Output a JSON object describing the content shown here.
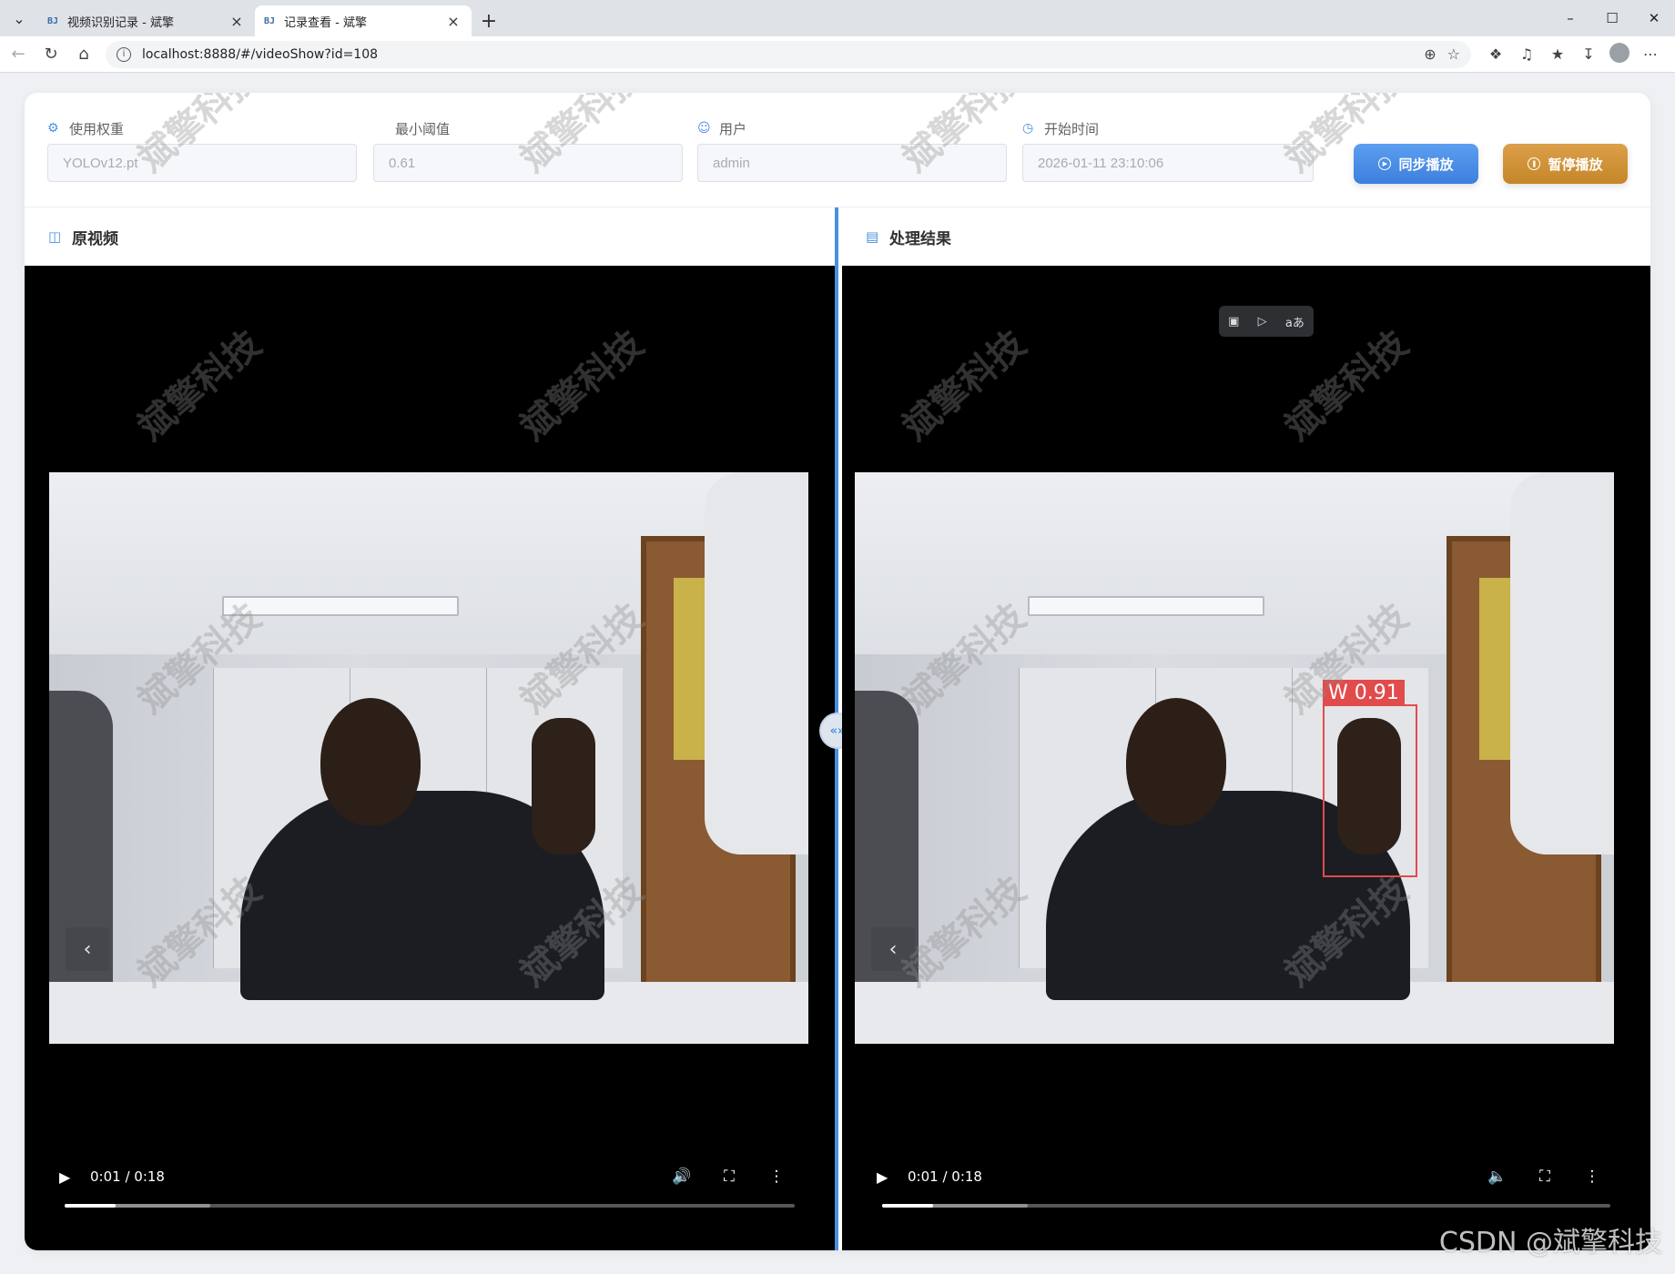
{
  "browser": {
    "tabs": [
      {
        "favicon": "BJ",
        "title": "视频识别记录 - 斌擎",
        "active": false
      },
      {
        "favicon": "BJ",
        "title": "记录查看 - 斌擎",
        "active": true
      }
    ],
    "url": "localhost:8888/#/videoShow?id=108"
  },
  "filters": {
    "weight": {
      "label": "使用权重",
      "value": "YOLOv12.pt"
    },
    "threshold": {
      "label": "最小阈值",
      "value": "0.61"
    },
    "user": {
      "label": "用户",
      "value": "admin"
    },
    "start_time": {
      "label": "开始时间",
      "value": "2026-01-11 23:10:06"
    }
  },
  "buttons": {
    "sync_play": "同步播放",
    "pause_play": "暂停播放"
  },
  "panels": {
    "original": {
      "title": "原视频",
      "time": "0:01 / 0:18",
      "progress": 0.07,
      "buffered": 0.2
    },
    "result": {
      "title": "处理结果",
      "time": "0:01 / 0:18",
      "progress": 0.07,
      "buffered": 0.2
    }
  },
  "detection": {
    "label": "W 0.91"
  },
  "overlay_tools": [
    "overlay-crop-icon",
    "overlay-visual-search-icon",
    "overlay-translate-icon"
  ],
  "overlay_translate_text": "aあ",
  "watermark": "斌擎科技",
  "csdn": "CSDN @斌擎科技",
  "colors": {
    "accent": "#4a90e2",
    "sync_button": "#3d7fdd",
    "pause_button": "#c58628",
    "bbox": "#e24b4b"
  }
}
